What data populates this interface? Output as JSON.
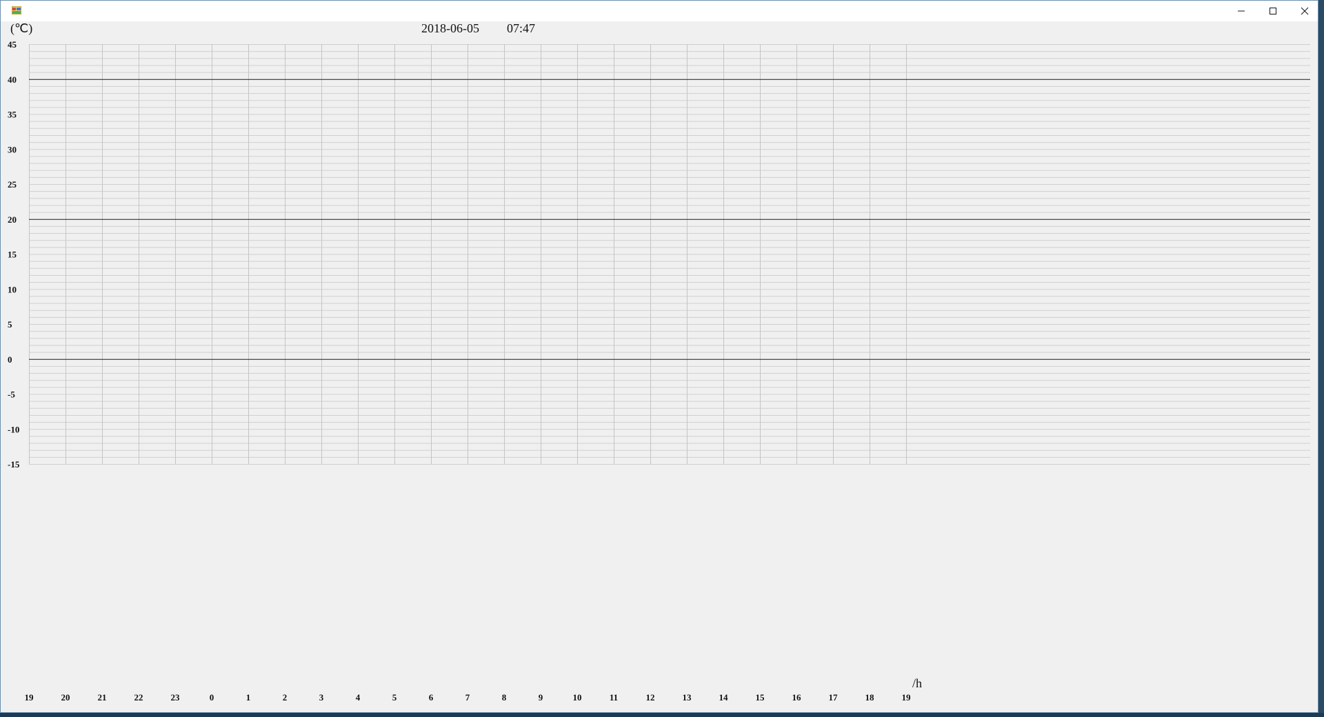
{
  "window": {
    "title_icon": "app-icon",
    "controls": {
      "minimize": "minimize-icon",
      "maximize": "maximize-icon",
      "close": "close-icon"
    }
  },
  "header": {
    "date": "2018-06-05",
    "time": "07:47"
  },
  "chart_data": {
    "type": "line",
    "ylabel": "(℃)",
    "xlabel": "/h",
    "ylim": [
      -15,
      45
    ],
    "y_ticks": [
      "45",
      "40",
      "35",
      "30",
      "25",
      "20",
      "15",
      "10",
      "5",
      "0",
      "-5",
      "-10",
      "-15"
    ],
    "y_major_every": 20,
    "y_minor_step": 1,
    "x_ticks": [
      "19",
      "20",
      "21",
      "22",
      "23",
      "0",
      "1",
      "2",
      "3",
      "4",
      "5",
      "6",
      "7",
      "8",
      "9",
      "10",
      "11",
      "12",
      "13",
      "14",
      "15",
      "16",
      "17",
      "18",
      "19"
    ],
    "series": [],
    "grid": true,
    "colors": {
      "grid": "#cfcfcf",
      "major": "#1a1a1a",
      "background": "#f0f0f0"
    }
  }
}
